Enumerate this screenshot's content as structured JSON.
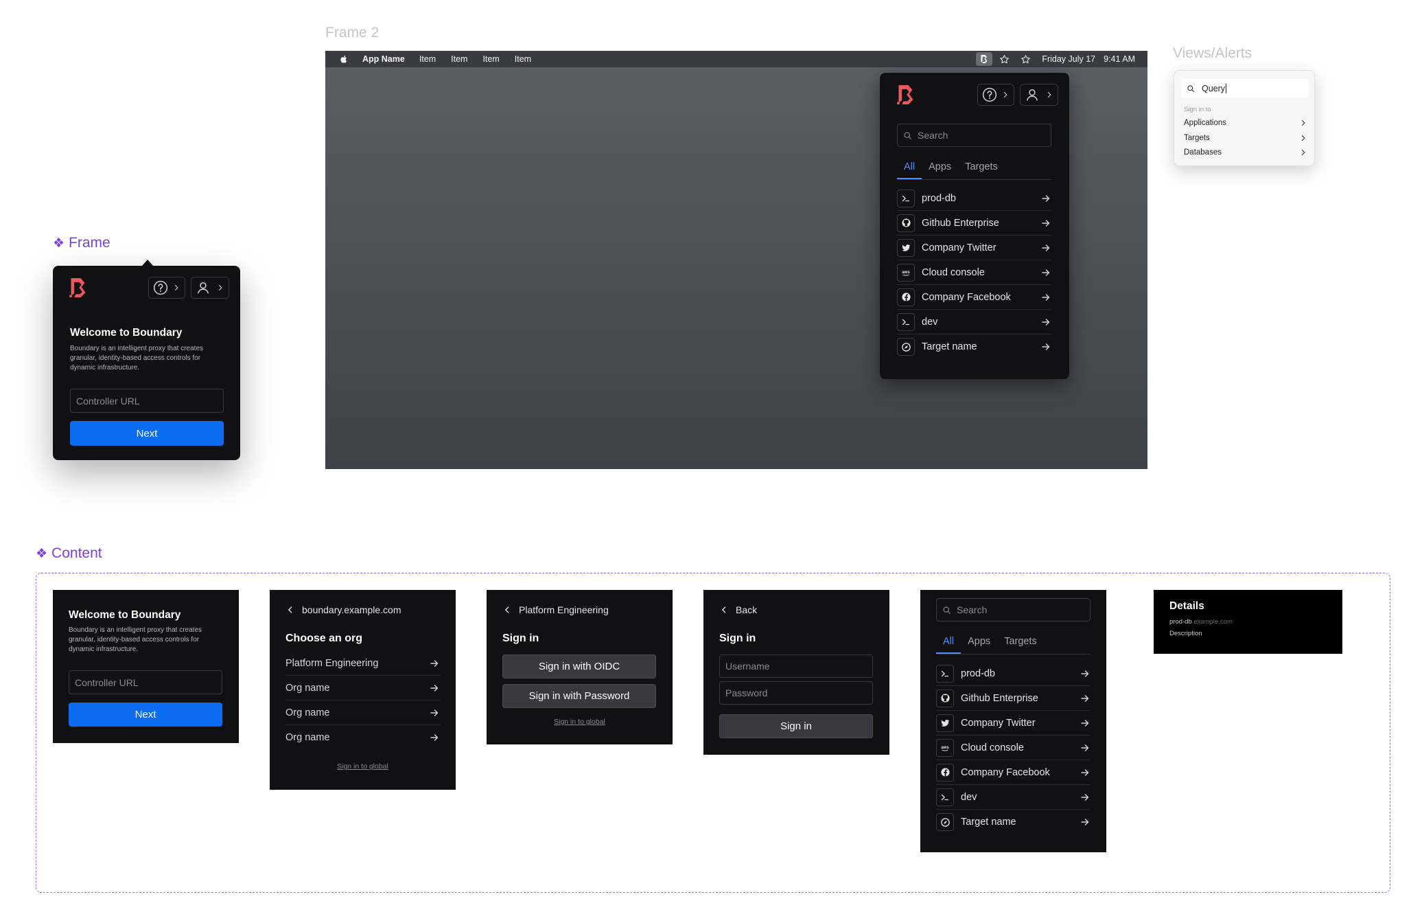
{
  "frame2": {
    "label": "Frame 2",
    "menubar": {
      "app_name": "App Name",
      "items": [
        "Item",
        "Item",
        "Item",
        "Item"
      ],
      "date": "Friday July 17",
      "time": "9:41 AM"
    },
    "popup": {
      "search_placeholder": "Search",
      "tabs": [
        "All",
        "Apps",
        "Targets"
      ],
      "targets": [
        {
          "name": "prod-db",
          "icon": "terminal-icon"
        },
        {
          "name": "Github Enterprise",
          "icon": "github-icon"
        },
        {
          "name": "Company Twitter",
          "icon": "twitter-icon"
        },
        {
          "name": "Cloud console",
          "icon": "aws-icon"
        },
        {
          "name": "Company Facebook",
          "icon": "facebook-icon"
        },
        {
          "name": "dev",
          "icon": "terminal-icon"
        },
        {
          "name": "Target name",
          "icon": "compass-icon"
        }
      ]
    }
  },
  "alerts": {
    "label": "Views/Alerts",
    "query": "Query",
    "section": "Sign in to",
    "items": [
      "Applications",
      "Targets",
      "Databases"
    ]
  },
  "frame": {
    "label": "Frame",
    "title": "Welcome to Boundary",
    "description": "Boundary is an intelligent proxy that creates granular, identity-based access controls for dynamic infrastructure.",
    "controller_placeholder": "Controller URL",
    "next_label": "Next"
  },
  "content": {
    "label": "Content",
    "welcome": {
      "title": "Welcome to Boundary",
      "description": "Boundary is an intelligent proxy that creates granular, identity-based access controls for dynamic infrastructure.",
      "controller_placeholder": "Controller URL",
      "next_label": "Next"
    },
    "org": {
      "back_label": "boundary.example.com",
      "title": "Choose an org",
      "orgs": [
        "Platform Engineering",
        "Org name",
        "Org name",
        "Org name"
      ],
      "global_link": "Sign in to global"
    },
    "signin_oidc": {
      "back_label": "Platform Engineering",
      "title": "Sign in",
      "oidc_label": "Sign in with OIDC",
      "password_label": "Sign in with Password",
      "global_link": "Sign in to global"
    },
    "signin_password": {
      "back_label": "Back",
      "title": "Sign in",
      "username_placeholder": "Username",
      "password_placeholder": "Password",
      "submit_label": "Sign in"
    },
    "targets": {
      "search_placeholder": "Search",
      "tabs": [
        "All",
        "Apps",
        "Targets"
      ],
      "items": [
        "prod-db",
        "Github Enterprise",
        "Company Twitter",
        "Cloud console",
        "Company Facebook",
        "dev",
        "Target name"
      ]
    },
    "details": {
      "title": "Details",
      "name": "prod-db",
      "host": ".example.com",
      "description": "Description"
    }
  },
  "colors": {
    "accent_blue": "#0c6cf2",
    "brand_red": "#ec585d",
    "purple": "#7b3fe4",
    "panel_dark": "#111113"
  }
}
